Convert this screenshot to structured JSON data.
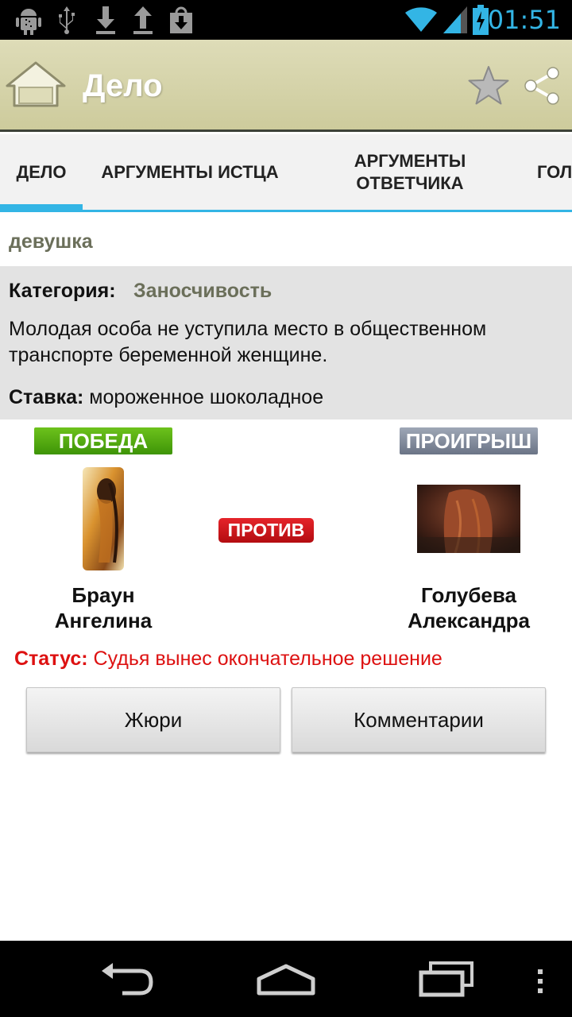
{
  "status_bar": {
    "time": "01:51"
  },
  "action_bar": {
    "title": "Дело"
  },
  "tabs": [
    {
      "label": "ДЕЛО"
    },
    {
      "label": "АРГУМЕНТЫ ИСТЦА"
    },
    {
      "label": "АРГУМЕНТЫ ОТВЕТЧИКА"
    },
    {
      "label": "ГОЛ"
    }
  ],
  "case": {
    "subtitle": "девушка",
    "category_label": "Категория:",
    "category_value": "Заносчивость",
    "description": "Молодая особа не уступила место в общественном транспорте беременной женщине.",
    "stake_label": "Ставка:",
    "stake_value": "мороженное шоколадное"
  },
  "versus": {
    "win_badge": "ПОБЕДА",
    "lose_badge": "ПРОИГРЫШ",
    "vs_label": "ПРОТИВ",
    "plaintiff_name": "Браун Ангелина",
    "defendant_name": "Голубева Александра"
  },
  "status": {
    "label": "Статус:",
    "value": "Судья вынес окончательное решение"
  },
  "buttons": {
    "jury": "Жюри",
    "comments": "Комментарии"
  },
  "colors": {
    "accent": "#33b5e5",
    "status_red": "#dd1111",
    "win_green": "#4fa90d",
    "lose_gray": "#7d8697",
    "vs_red": "#d0181d",
    "category_olive": "#6b6f5a"
  }
}
